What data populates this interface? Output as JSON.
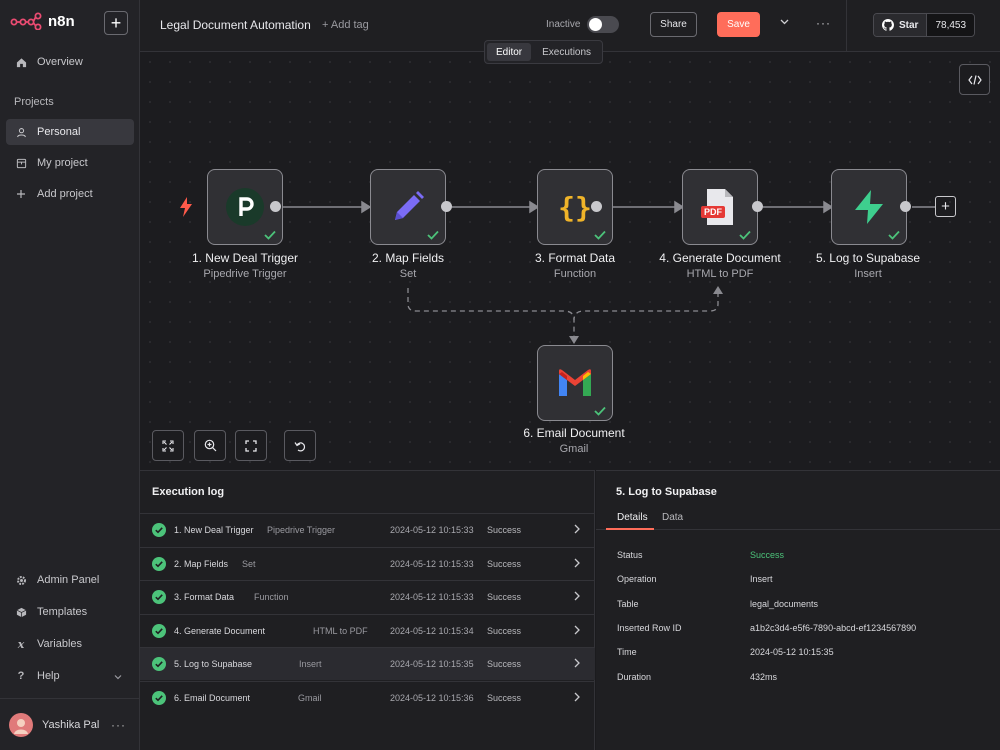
{
  "app": {
    "name": "n8n"
  },
  "sidebar": {
    "overview": "Overview",
    "projects_label": "Projects",
    "items": [
      {
        "label": "Personal"
      },
      {
        "label": "My project"
      },
      {
        "label": "Add project"
      }
    ],
    "bottom_items": [
      {
        "label": "Admin Panel"
      },
      {
        "label": "Templates"
      },
      {
        "label": "Variables"
      },
      {
        "label": "Help"
      }
    ],
    "user": {
      "name": "Yashika Pal"
    }
  },
  "header": {
    "workflow_title": "Legal Document Automation",
    "add_tag": "+ Add tag",
    "status_label": "Inactive",
    "share": "Share",
    "save": "Save",
    "github": {
      "label": "Star",
      "count": "78,453"
    }
  },
  "view_tabs": {
    "editor": "Editor",
    "executions": "Executions"
  },
  "nodes": [
    {
      "title": "1. New Deal Trigger",
      "subtitle": "Pipedrive Trigger",
      "icon": "pipedrive-icon"
    },
    {
      "title": "2. Map Fields",
      "subtitle": "Set",
      "icon": "pencil-icon"
    },
    {
      "title": "3. Format Data",
      "subtitle": "Function",
      "icon": "braces-icon"
    },
    {
      "title": "4. Generate Document",
      "subtitle": "HTML to PDF",
      "icon": "pdf-icon",
      "pdf_badge": "PDF"
    },
    {
      "title": "5. Log to Supabase",
      "subtitle": "Insert",
      "icon": "supabase-icon"
    },
    {
      "title": "6. Email Document",
      "subtitle": "Gmail",
      "icon": "gmail-icon"
    }
  ],
  "execution_log": {
    "title": "Execution log",
    "rows": [
      {
        "name": "1. New Deal Trigger",
        "type": "Pipedrive Trigger",
        "time": "2024-05-12 10:15:33",
        "status": "Success"
      },
      {
        "name": "2. Map Fields",
        "type": "Set",
        "time": "2024-05-12 10:15:33",
        "status": "Success"
      },
      {
        "name": "3. Format Data",
        "type": "Function",
        "time": "2024-05-12 10:15:33",
        "status": "Success"
      },
      {
        "name": "4. Generate Document",
        "type": "HTML to PDF",
        "time": "2024-05-12 10:15:34",
        "status": "Success"
      },
      {
        "name": "5. Log to Supabase",
        "type": "Insert",
        "time": "2024-05-12 10:15:35",
        "status": "Success"
      },
      {
        "name": "6. Email Document",
        "type": "Gmail",
        "time": "2024-05-12 10:15:36",
        "status": "Success"
      }
    ]
  },
  "details": {
    "title": "5. Log to Supabase",
    "tabs": [
      "Details",
      "Data"
    ],
    "fields": [
      {
        "key": "Status",
        "value": "Success"
      },
      {
        "key": "Operation",
        "value": "Insert"
      },
      {
        "key": "Table",
        "value": "legal_documents"
      },
      {
        "key": "Inserted Row ID",
        "value": "a1b2c3d4-e5f6-7890-abcd-ef1234567890"
      },
      {
        "key": "Time",
        "value": "2024-05-12 10:15:35"
      },
      {
        "key": "Duration",
        "value": "432ms"
      }
    ]
  },
  "colors": {
    "accent": "#ff6d5a",
    "success": "#4cc37a",
    "pipedrive": "#1a3a2a",
    "supabase": "#3ecf8e"
  }
}
